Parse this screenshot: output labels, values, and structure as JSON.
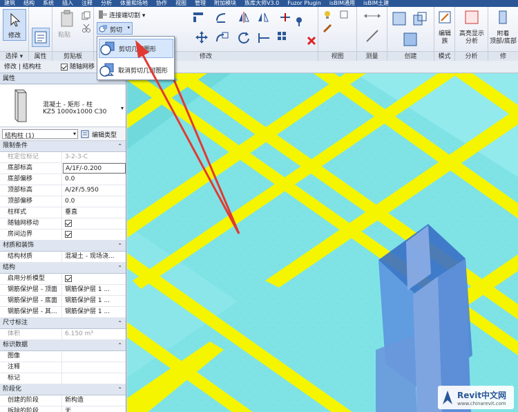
{
  "menu": [
    "建筑",
    "结构",
    "系统",
    "插入",
    "注释",
    "分析",
    "体量和场地",
    "协作",
    "视图",
    "管理",
    "附加模块",
    "族库大师V3.0",
    "Fuzor Plugin",
    "isBIM通用",
    "isBIM土建"
  ],
  "ribbon": {
    "modify_label": "修改",
    "select_label": "选择 ▾",
    "properties_label": "属性",
    "paste_label": "粘贴",
    "clipboard_label": "剪贴板",
    "join_label": "连接端切割 ▾",
    "cut_label": "剪切",
    "modify_panel_label": "修改",
    "view_panel_label": "视图",
    "measure_panel_label": "测量",
    "create_panel_label": "创建",
    "mode_panel_label": "模式",
    "analysis_panel_label": "分析",
    "edit_family_label": "编辑\n族",
    "highlight_label": "高亮显示\n分析",
    "attach_label": "附着\n顶部/底部",
    "cut_edge_label": "修"
  },
  "dropdown": {
    "items": [
      {
        "label": "剪切几何图形",
        "icon": "cut-geometry-icon"
      },
      {
        "label": "取消剪切几何图形",
        "icon": "uncut-geometry-icon"
      }
    ]
  },
  "context_bar": {
    "breadcrumb": "修改 | 结构柱",
    "checkbox_label": "随轴网移"
  },
  "properties": {
    "title": "属性",
    "family": "混凝土 - 矩形 - 柱",
    "type": "KZ5 1000x1000 C30",
    "instance_filter": "结构柱 (1)",
    "edit_type": "编辑类型",
    "groups": [
      {
        "name": "限制条件",
        "rows": [
          {
            "k": "柱定位标记",
            "v": "3-2-3-C",
            "gray": true
          },
          {
            "k": "底部标高",
            "v": "A/1F/-0.200",
            "boxed": true
          },
          {
            "k": "底部偏移",
            "v": "0.0"
          },
          {
            "k": "顶部标高",
            "v": "A/2F/5.950"
          },
          {
            "k": "顶部偏移",
            "v": "0.0"
          },
          {
            "k": "柱样式",
            "v": "垂直"
          },
          {
            "k": "随轴网移动",
            "check": true
          },
          {
            "k": "房间边界",
            "check": true
          }
        ]
      },
      {
        "name": "材质和装饰",
        "rows": [
          {
            "k": "结构材质",
            "v": "混凝土 - 现场浇..."
          }
        ]
      },
      {
        "name": "结构",
        "rows": [
          {
            "k": "启用分析模型",
            "check": true
          },
          {
            "k": "钢筋保护层 - 顶面",
            "v": "钢筋保护层 1 ..."
          },
          {
            "k": "钢筋保护层 - 底面",
            "v": "钢筋保护层 1 ..."
          },
          {
            "k": "钢筋保护层 - 其...",
            "v": "钢筋保护层 1 ..."
          }
        ]
      },
      {
        "name": "尺寸标注",
        "rows": [
          {
            "k": "体积",
            "v": "6.150 m³",
            "gray": true
          }
        ]
      },
      {
        "name": "标识数据",
        "rows": [
          {
            "k": "图像",
            "v": ""
          },
          {
            "k": "注释",
            "v": ""
          },
          {
            "k": "标记",
            "v": ""
          }
        ]
      },
      {
        "name": "阶段化",
        "rows": [
          {
            "k": "创建的阶段",
            "v": "新构造"
          },
          {
            "k": "拆除的阶段",
            "v": "无"
          }
        ]
      }
    ]
  },
  "watermark": {
    "brand": "Revit中文网",
    "url": "www.chinarevit.com"
  },
  "colors": {
    "beam": "#f5f500",
    "slab": "#7fe3e6",
    "column": "#4a7fd1",
    "arrow": "#e03a32"
  }
}
